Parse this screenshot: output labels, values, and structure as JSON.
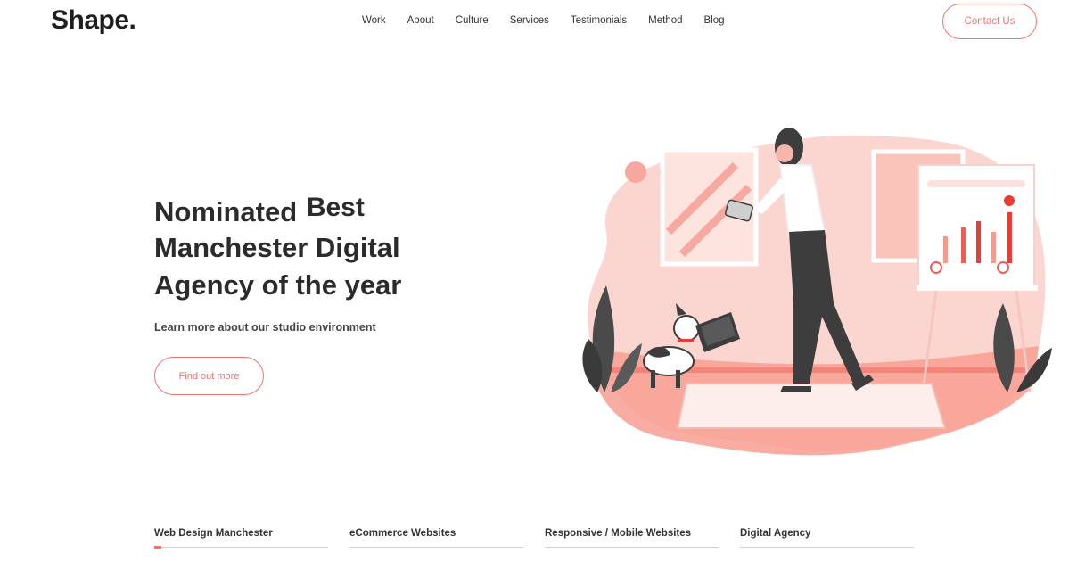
{
  "brand": {
    "logo": "Shape."
  },
  "nav": {
    "items": [
      "Work",
      "About",
      "Culture",
      "Services",
      "Testimonials",
      "Method",
      "Blog"
    ]
  },
  "header": {
    "contact_label": "Contact Us"
  },
  "hero": {
    "title_line1_a": "Nominated",
    "title_line1_b": "Best",
    "title_line2": "Manchester Digital",
    "title_line3": "Agency of the year",
    "subtitle": "Learn more about our studio environment",
    "cta_label": "Find out more"
  },
  "tabs": [
    {
      "label": "Web Design Manchester",
      "active": true,
      "progress": 0.04
    },
    {
      "label": "eCommerce Websites",
      "active": false,
      "progress": 0
    },
    {
      "label": "Responsive / Mobile Websites",
      "active": false,
      "progress": 0
    },
    {
      "label": "Digital Agency",
      "active": false,
      "progress": 0
    }
  ],
  "colors": {
    "accent": "#f0736f",
    "blob": "#fbd5cf",
    "dark": "#3d3d3d"
  }
}
